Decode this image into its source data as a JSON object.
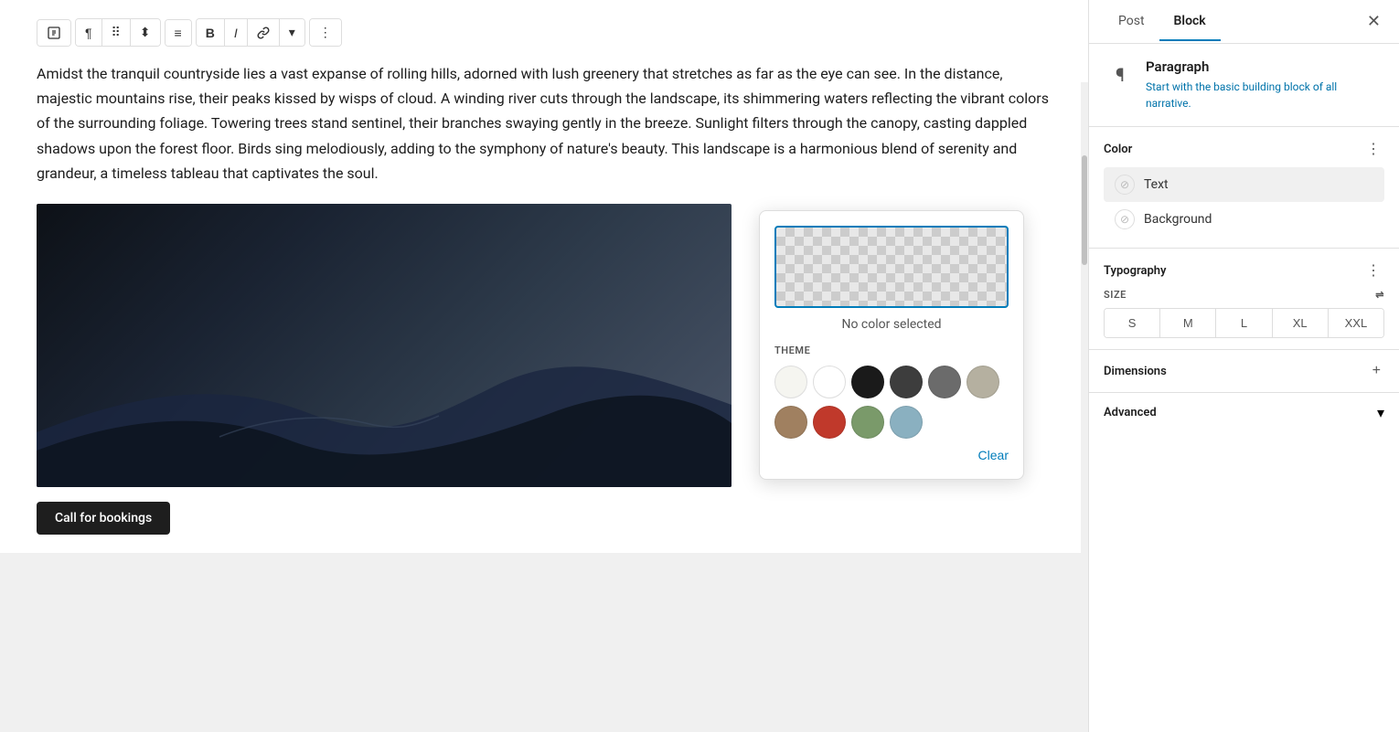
{
  "tabs": {
    "post": "Post",
    "block": "Block"
  },
  "block": {
    "name": "Paragraph",
    "description": "Start with the basic building block of all narrative."
  },
  "toolbar": {
    "buttons": [
      "link-icon",
      "paragraph-icon",
      "drag-icon",
      "move-icon",
      "align-icon",
      "bold-icon",
      "italic-icon",
      "link2-icon",
      "dropdown-icon",
      "more-icon"
    ]
  },
  "content": {
    "text": "Amidst the tranquil countryside lies a vast expanse of rolling hills, adorned with lush greenery that stretches as far as the eye can see. In the distance, majestic mountains rise, their peaks kissed by wisps of cloud. A winding river cuts through the landscape, its shimmering waters reflecting the vibrant colors of the surrounding foliage. Towering trees stand sentinel, their branches swaying gently in the breeze. Sunlight filters through the canopy, casting dappled shadows upon the forest floor. Birds sing melodiously, adding to the symphony of nature's beauty. This landscape is a harmonious blend of serenity and grandeur, a timeless tableau that captivates the soul.",
    "cta": "Call for bookings"
  },
  "color_picker": {
    "no_color_text": "No color selected",
    "theme_label": "THEME",
    "clear_label": "Clear",
    "swatches_row1": [
      {
        "color": "#f5f5f0",
        "name": "off-white"
      },
      {
        "color": "#ffffff",
        "name": "white"
      },
      {
        "color": "#1a1a1a",
        "name": "black"
      },
      {
        "color": "#3d3d3d",
        "name": "dark-gray"
      },
      {
        "color": "#6b6b6b",
        "name": "medium-gray"
      },
      {
        "color": "#b5b0a0",
        "name": "light-tan"
      }
    ],
    "swatches_row2": [
      {
        "color": "#a08060",
        "name": "tan"
      },
      {
        "color": "#c0392b",
        "name": "red"
      },
      {
        "color": "#7a9a6a",
        "name": "green"
      },
      {
        "color": "#8ab0c0",
        "name": "light-blue"
      }
    ]
  },
  "color_section": {
    "title": "Color",
    "text_label": "Text",
    "background_label": "Background"
  },
  "typography_section": {
    "title": "Typography",
    "size_label": "SIZE",
    "sizes": [
      "S",
      "M",
      "L",
      "XL",
      "XXL"
    ]
  },
  "dimensions_section": {
    "title": "Dimensions",
    "add_icon": "+"
  },
  "advanced_section": {
    "title": "Advanced",
    "chevron": "▾"
  }
}
